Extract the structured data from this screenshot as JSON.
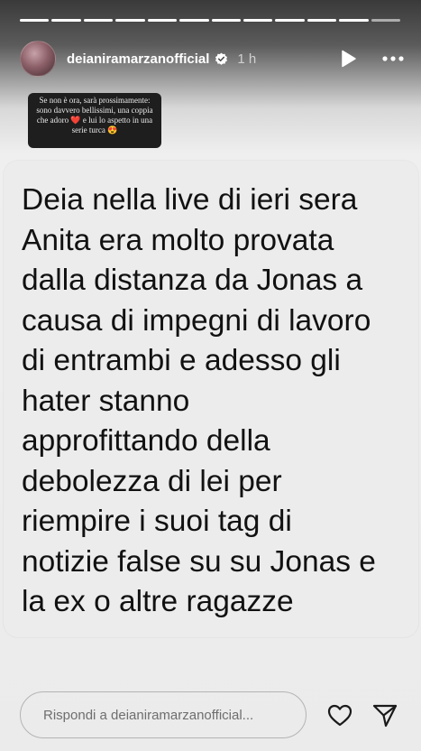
{
  "story": {
    "segments_total": 12,
    "segments_viewed": 11
  },
  "header": {
    "username": "deianiramarzanofficial",
    "time": "1 h",
    "verified_icon": "verified-badge-icon",
    "play_icon": "play-icon",
    "more_icon": "more-options-icon"
  },
  "quote": {
    "text": "Se non è ora, sarà prossimamente: sono davvero bellissimi, una coppia che adoro ❤️ e lui lo aspetto in una serie turca 😍"
  },
  "card": {
    "text": "Deia nella live di ieri sera\nAnita era molto provata\ndalla distanza da Jonas a\ncausa di impegni di lavoro\ndi entrambi e adesso gli\nhater stanno\napprofittando della\ndebolezza di lei per\nriempire i suoi tag di\nnotizie false su su Jonas e\nla ex o altre ragazze"
  },
  "footer": {
    "reply_placeholder": "Rispondi a deianiramarzanofficial...",
    "like_icon": "heart-icon",
    "share_icon": "send-icon"
  },
  "colors": {
    "card_background": "#ececec",
    "text": "#111111",
    "header_text": "#ffffff"
  }
}
